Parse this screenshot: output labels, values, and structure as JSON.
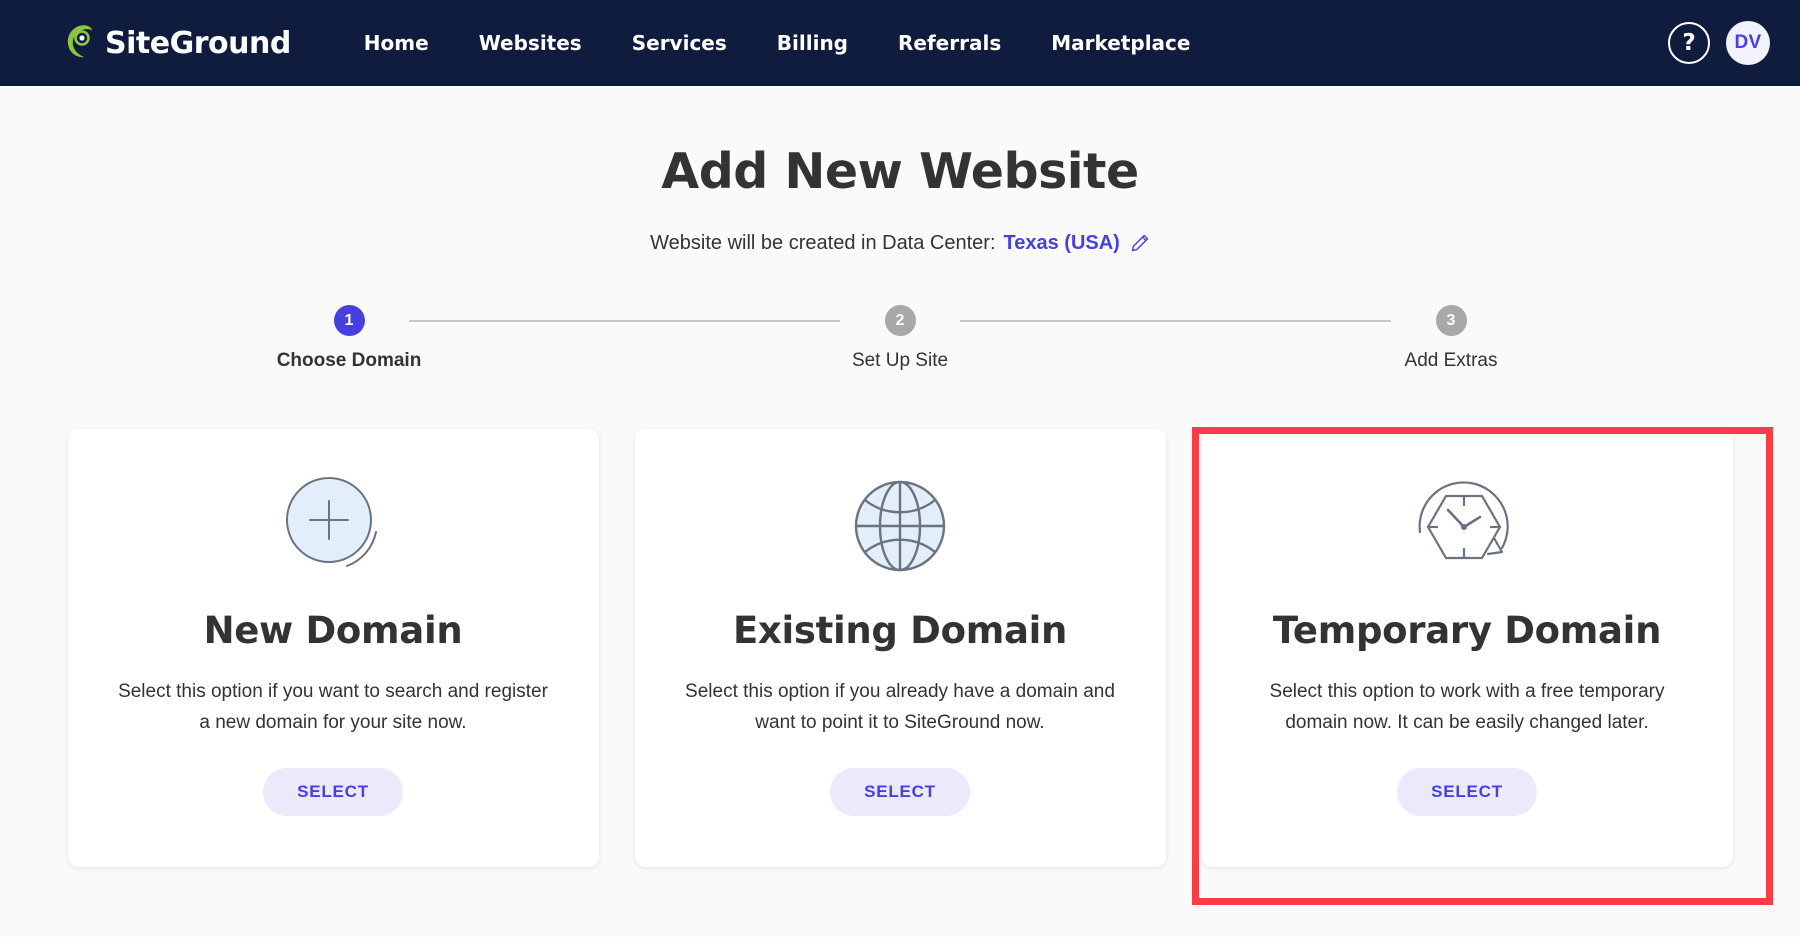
{
  "topnav": {
    "brand_name": "SiteGround",
    "brand_logo_icon": "siteground-spiral-logo",
    "links": [
      {
        "label": "Home"
      },
      {
        "label": "Websites"
      },
      {
        "label": "Services"
      },
      {
        "label": "Billing"
      },
      {
        "label": "Referrals"
      },
      {
        "label": "Marketplace"
      }
    ],
    "help_label": "?",
    "avatar_initials": "DV",
    "background_color": "#101c3d",
    "avatar_text_color": "#4640e0"
  },
  "main": {
    "title": "Add New Website",
    "datacenter_prefix": "Website will be created in Data Center:",
    "datacenter_value": "Texas (USA)",
    "edit_icon": "pencil-icon",
    "accent_color": "#4640e0"
  },
  "stepper": {
    "steps": [
      {
        "number": "1",
        "label": "Choose Domain",
        "state": "active"
      },
      {
        "number": "2",
        "label": "Set Up Site",
        "state": "inactive"
      },
      {
        "number": "3",
        "label": "Add Extras",
        "state": "inactive"
      }
    ],
    "active_color": "#4640e0",
    "inactive_color": "#a8a8a8"
  },
  "cards": [
    {
      "icon": "plus-circle-icon",
      "title": "New Domain",
      "description": "Select this option if you want to search and register a new domain for your site now.",
      "button_label": "SELECT",
      "highlighted": false
    },
    {
      "icon": "globe-icon",
      "title": "Existing Domain",
      "description": "Select this option if you already have a domain and want to point it to SiteGround now.",
      "button_label": "SELECT",
      "highlighted": false
    },
    {
      "icon": "temporary-clock-icon",
      "title": "Temporary Domain",
      "description": "Select this option to work with a free temporary domain now. It can be easily changed later.",
      "button_label": "SELECT",
      "highlighted": true
    }
  ],
  "highlight": {
    "color": "#fa3c46",
    "target": "temporary-domain-card"
  }
}
